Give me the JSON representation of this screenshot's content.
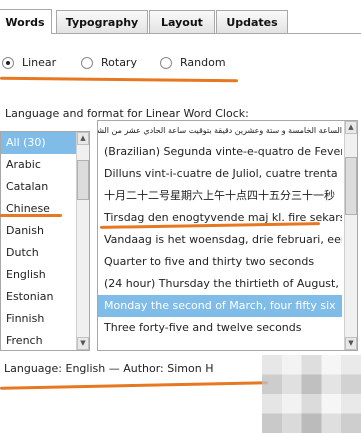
{
  "tabs": [
    {
      "label": "Words",
      "active": true
    },
    {
      "label": "Typography",
      "active": false
    },
    {
      "label": "Layout",
      "active": false
    },
    {
      "label": "Updates",
      "active": false
    }
  ],
  "radios": [
    {
      "label": "Linear",
      "checked": true
    },
    {
      "label": "Rotary",
      "checked": false
    },
    {
      "label": "Random",
      "checked": false
    }
  ],
  "section_label": "Language and format for Linear Word Clock:",
  "languages": {
    "items": [
      "All (30)",
      "Arabic",
      "Catalan",
      "Chinese",
      "Danish",
      "Dutch",
      "English",
      "Estonian",
      "Finnish",
      "French"
    ],
    "selected": "All (30)"
  },
  "clock_samples": {
    "items": [
      "الساعة الخامسة و ستة وعشرين دقيقة بتوقيت ساعة الحادي عشر من الشهر السادس",
      "(Brazilian) Segunda vinte-e-quatro de Fevereiro",
      "Dilluns vint-i-cuatre de Juliol, cuatre trenta",
      "十月二十二号星期六上午十点四十五分三十一秒",
      "Tirsdag den enogtyvende maj kl. fire sekars",
      "Vandaag is het woensdag, drie februari, een",
      "Quarter to five and thirty two seconds",
      "(24 hour) Thursday the thirtieth of August,",
      "Monday the second of March, four fifty six",
      "Three forty-five and twelve seconds"
    ],
    "selected_index": 8
  },
  "footer": "Language: English — Author: Simon H",
  "colors": {
    "selection": "#7fbde8",
    "annotation": "#e87722",
    "border": "#a8a8a8"
  }
}
